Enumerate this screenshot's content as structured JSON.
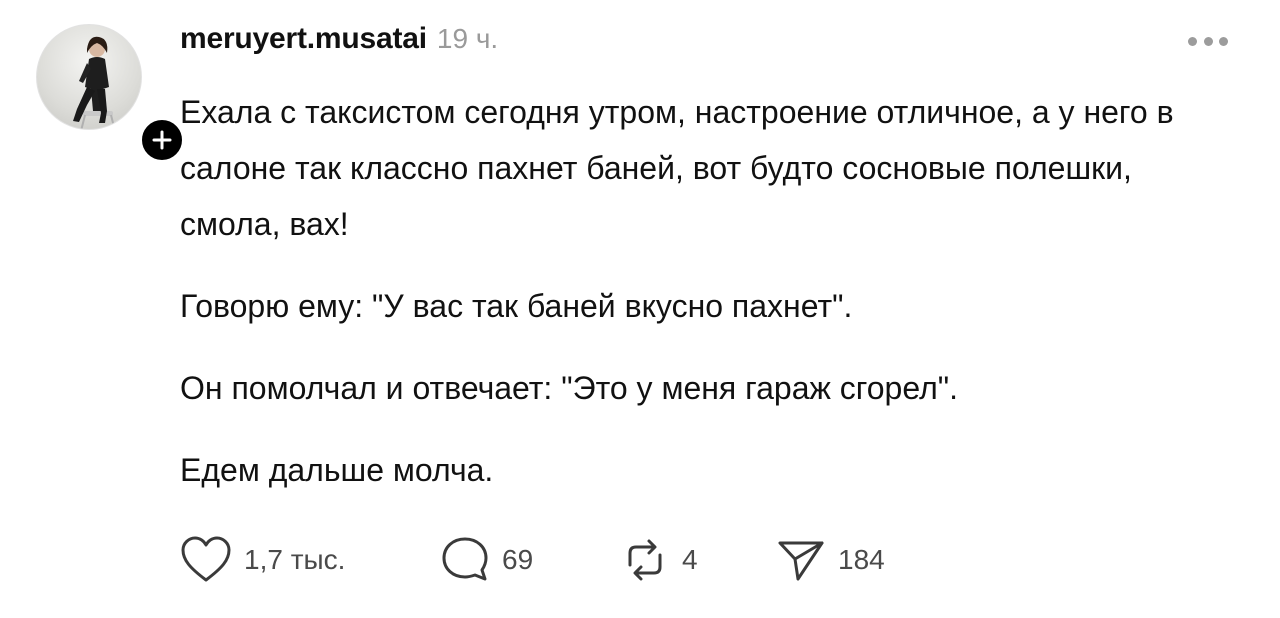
{
  "post": {
    "author": "meruyert.musatai",
    "timestamp": "19 ч.",
    "paragraphs": [
      "Ехала с таксистом сегодня утром, настроение отличное, а у него в салоне так классно пахнет баней, вот будто сосновые полешки, смола, вах!",
      "Говорю ему: \"У вас так баней вкусно пахнет\".",
      "Он помолчал и отвечает: \"Это у меня гараж сгорел\".",
      "Едем дальше молча."
    ],
    "actions": {
      "likes": "1,7 тыс.",
      "comments": "69",
      "reposts": "4",
      "shares": "184"
    }
  },
  "icons": {
    "avatar": "avatar-photo",
    "follow": "plus-icon",
    "more": "more-horizontal-icon",
    "like": "heart-icon",
    "comment": "speech-bubble-icon",
    "repost": "repost-arrows-icon",
    "share": "paper-plane-icon"
  },
  "colors": {
    "text": "#111111",
    "muted": "#9a9a9a",
    "icon": "#3a3a3a",
    "badge": "#000000"
  }
}
